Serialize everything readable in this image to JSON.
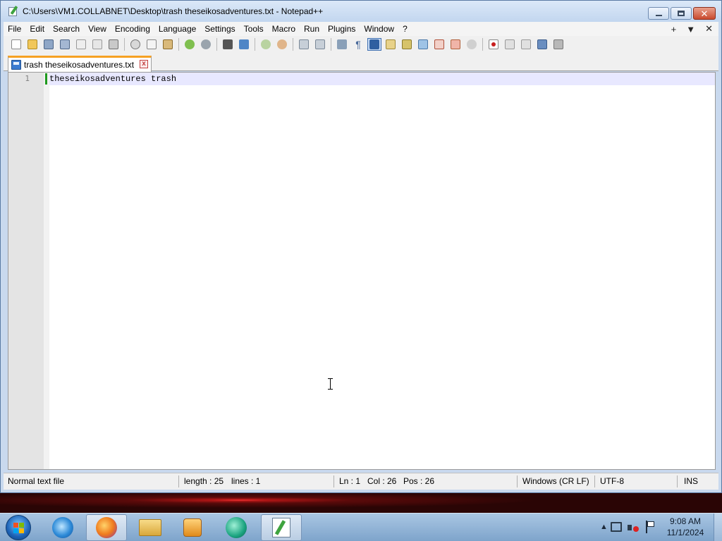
{
  "window": {
    "title": "C:\\Users\\VM1.COLLABNET\\Desktop\\trash theseikosadventures.txt - Notepad++"
  },
  "menu": {
    "items": [
      "File",
      "Edit",
      "Search",
      "View",
      "Encoding",
      "Language",
      "Settings",
      "Tools",
      "Macro",
      "Run",
      "Plugins",
      "Window",
      "?"
    ],
    "right_plus": "+",
    "right_down": "▼",
    "right_close": "✕"
  },
  "toolbar": {
    "icons": [
      "new-file-icon",
      "open-file-icon",
      "save-icon",
      "save-all-icon",
      "close-icon",
      "close-all-icon",
      "print-icon",
      "cut-icon",
      "copy-icon",
      "paste-icon",
      "undo-icon",
      "redo-icon",
      "find-icon",
      "replace-icon",
      "zoom-in-icon",
      "zoom-out-icon",
      "sync-vertical-icon",
      "sync-horizontal-icon",
      "word-wrap-icon",
      "show-all-chars-icon",
      "indent-guide-icon",
      "user-language-icon",
      "doc-map-icon",
      "doc-list-icon",
      "function-list-icon",
      "folder-workspace-icon",
      "monitoring-icon",
      "record-macro-icon",
      "stop-record-icon",
      "play-macro-icon",
      "run-macro-multiple-icon",
      "save-macro-icon"
    ]
  },
  "tab": {
    "label": "trash theseikosadventures.txt",
    "close_glyph": "x"
  },
  "editor": {
    "line_number": "1",
    "text": "theseikosadventures trash"
  },
  "status": {
    "file_type": "Normal text file",
    "length": "length : 25",
    "lines": "lines : 1",
    "ln": "Ln : 1",
    "col": "Col : 26",
    "pos": "Pos : 26",
    "eol": "Windows (CR LF)",
    "encoding": "UTF-8",
    "mode": "INS"
  },
  "taskbar": {
    "time": "9:08 AM",
    "date": "11/1/2024",
    "tray_up": "▲"
  },
  "colors": {
    "tab_accent": "#f6a123",
    "current_line": "#e8e8ff",
    "change_marker": "#1e9a1e"
  }
}
